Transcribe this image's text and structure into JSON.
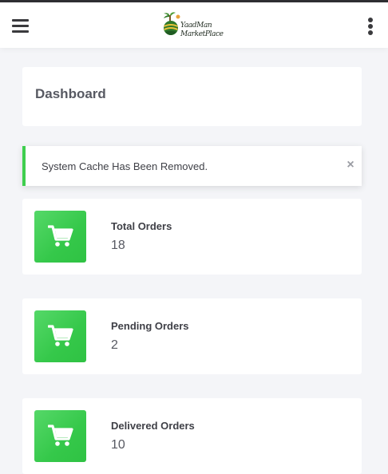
{
  "header": {
    "menu_icon": "hamburger-icon",
    "logo_line1": "YaadMan",
    "logo_line2": "MarketPlace",
    "more_icon": "vertical-dots-icon"
  },
  "page": {
    "title": "Dashboard"
  },
  "alert": {
    "message": "System Cache Has Been Removed.",
    "close_label": "×",
    "accent": "#3fce4e"
  },
  "cards": [
    {
      "label": "Total Orders",
      "value": "18",
      "icon": "shopping-cart-icon"
    },
    {
      "label": "Pending Orders",
      "value": "2",
      "icon": "shopping-cart-icon"
    },
    {
      "label": "Delivered Orders",
      "value": "10",
      "icon": "shopping-cart-icon"
    }
  ],
  "colors": {
    "icon_bg": "#38c94c",
    "background": "#f4f5f8",
    "header": "#ffffff"
  }
}
